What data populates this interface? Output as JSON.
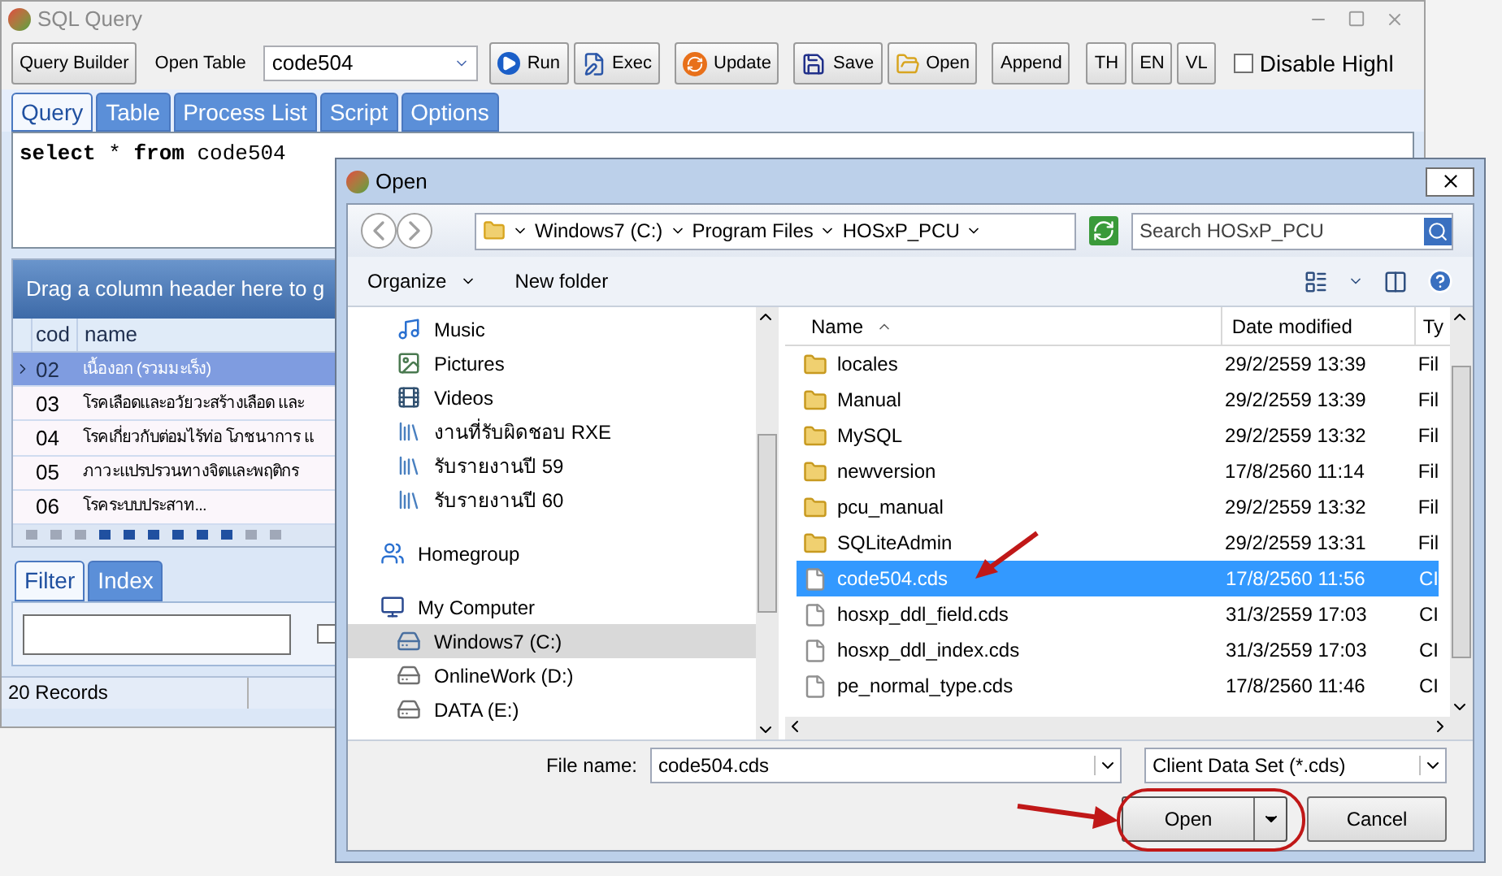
{
  "main_window": {
    "title": "SQL Query",
    "toolbar": {
      "query_builder": "Query Builder",
      "open_table_label": "Open Table",
      "table_field": "code504",
      "buttons": [
        {
          "label": "Run",
          "kind": "run"
        },
        {
          "label": "Exec",
          "kind": "exec"
        },
        {
          "label": "Update",
          "kind": "update"
        },
        {
          "label": "Save",
          "kind": "save"
        },
        {
          "label": "Open",
          "kind": "open"
        },
        {
          "label": "Append",
          "kind": "plain"
        }
      ],
      "lang_buttons": [
        "TH",
        "EN",
        "VL"
      ],
      "disable_highlight": {
        "label": "Disable Highl",
        "checked": false
      }
    },
    "tabs": [
      {
        "label": "Query",
        "selected": true
      },
      {
        "label": "Table",
        "selected": false
      },
      {
        "label": "Process List",
        "selected": false
      },
      {
        "label": "Script",
        "selected": false
      },
      {
        "label": "Options",
        "selected": false
      }
    ],
    "query": "**select** * **from** code504",
    "grid": {
      "group_hint": "Drag a column header here to g",
      "columns": [
        "cod",
        "name"
      ],
      "rows": [
        {
          "code": "02",
          "name": "เนื้องอก (รวมมะเร็ง)",
          "selected": true
        },
        {
          "code": "03",
          "name": "โรคเลือดและอวัยวะสร้างเลือด และ",
          "selected": false
        },
        {
          "code": "04",
          "name": "โรคเกี่ยวกับต่อมไร้ท่อ โภชนาการ แ",
          "selected": false
        },
        {
          "code": "05",
          "name": "ภาวะแปรปรวนทางจิตและพฤติกร",
          "selected": false
        },
        {
          "code": "06",
          "name": "โรคระบบประสาท...",
          "selected": false
        }
      ]
    },
    "filter_tabs": [
      {
        "label": "Filter",
        "selected": true
      },
      {
        "label": "Index",
        "selected": false
      }
    ],
    "filter_option": {
      "checked": false
    },
    "status_bar": "20 Records"
  },
  "dialog": {
    "title": "Open",
    "breadcrumb": [
      "Windows7 (C:)",
      "Program Files",
      "HOSxP_PCU"
    ],
    "search": {
      "placeholder": "Search HOSxP_PCU"
    },
    "commands": [
      "Organize",
      "New folder"
    ],
    "nav": [
      {
        "label": "Music",
        "kind": "music",
        "selected": false
      },
      {
        "label": "Pictures",
        "kind": "pictures",
        "selected": false
      },
      {
        "label": "Videos",
        "kind": "videos",
        "selected": false
      },
      {
        "label": "งานที่รับผิดชอบ RXE",
        "kind": "library",
        "selected": false
      },
      {
        "label": "รับรายงานปี 59",
        "kind": "library",
        "selected": false
      },
      {
        "label": "รับรายงานปี 60",
        "kind": "library",
        "selected": false
      },
      {
        "label": "Homegroup",
        "kind": "homegroup",
        "selected": false
      },
      {
        "label": "My Computer",
        "kind": "computer",
        "selected": false,
        "children": [
          {
            "label": "Windows7 (C:)",
            "kind": "system-drive",
            "selected": true
          },
          {
            "label": "OnlineWork (D:)",
            "kind": "drive",
            "selected": false
          },
          {
            "label": "DATA (E:)",
            "kind": "drive",
            "selected": false
          }
        ]
      }
    ],
    "columns": [
      "Name",
      "Date modified",
      "Ty"
    ],
    "files": [
      {
        "name": "locales",
        "date": "29/2/2559 13:39",
        "type": "Fil",
        "kind": "folder",
        "selected": false
      },
      {
        "name": "Manual",
        "date": "29/2/2559 13:39",
        "type": "Fil",
        "kind": "folder",
        "selected": false
      },
      {
        "name": "MySQL",
        "date": "29/2/2559 13:32",
        "type": "Fil",
        "kind": "folder",
        "selected": false
      },
      {
        "name": "newversion",
        "date": "17/8/2560 11:14",
        "type": "Fil",
        "kind": "folder",
        "selected": false
      },
      {
        "name": "pcu_manual",
        "date": "29/2/2559 13:32",
        "type": "Fil",
        "kind": "folder",
        "selected": false
      },
      {
        "name": "SQLiteAdmin",
        "date": "29/2/2559 13:31",
        "type": "Fil",
        "kind": "folder",
        "selected": false
      },
      {
        "name": "code504.cds",
        "date": "17/8/2560 11:56",
        "type": "CI",
        "kind": "file",
        "selected": true
      },
      {
        "name": "hosxp_ddl_field.cds",
        "date": "31/3/2559 17:03",
        "type": "CI",
        "kind": "file",
        "selected": false
      },
      {
        "name": "hosxp_ddl_index.cds",
        "date": "31/3/2559 17:03",
        "type": "CI",
        "kind": "file",
        "selected": false
      },
      {
        "name": "pe_normal_type.cds",
        "date": "17/8/2560 11:46",
        "type": "CI",
        "kind": "file",
        "selected": false
      }
    ],
    "file_name": {
      "label": "File name:",
      "value": "code504.cds"
    },
    "file_type": "Client Data Set (*.cds)",
    "buttons": [
      {
        "label": "Open",
        "kind": "split"
      },
      {
        "label": "Cancel",
        "kind": "plain"
      }
    ]
  }
}
